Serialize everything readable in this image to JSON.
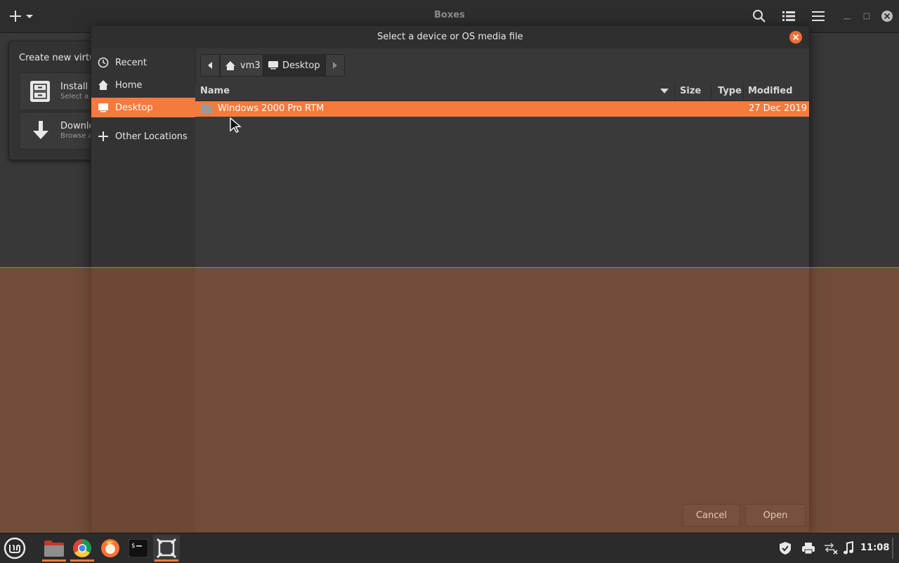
{
  "app": {
    "title": "Boxes"
  },
  "popover": {
    "title": "Create new virtual",
    "items": [
      {
        "label": "Install",
        "sublabel": "Select a"
      },
      {
        "label": "Downlo",
        "sublabel": "Browse a"
      }
    ]
  },
  "dialog": {
    "title": "Select a device or OS media file",
    "places": [
      {
        "label": "Recent",
        "icon": "clock-icon"
      },
      {
        "label": "Home",
        "icon": "home-icon"
      },
      {
        "label": "Desktop",
        "icon": "desktop-icon",
        "selected": true
      },
      {
        "label": "Other Locations",
        "icon": "plus-icon"
      }
    ],
    "pathbar": [
      "vm3",
      "Desktop"
    ],
    "columns": {
      "name": "Name",
      "size": "Size",
      "type": "Type",
      "modified": "Modified"
    },
    "files": [
      {
        "name": "Windows 2000 Pro RTM",
        "size": "",
        "type": "",
        "modified": "27 Dec 2019",
        "kind": "folder"
      }
    ],
    "buttons": {
      "cancel": "Cancel",
      "open": "Open"
    }
  },
  "taskbar": {
    "clock": "11:08",
    "accent": "#f47a3e"
  }
}
